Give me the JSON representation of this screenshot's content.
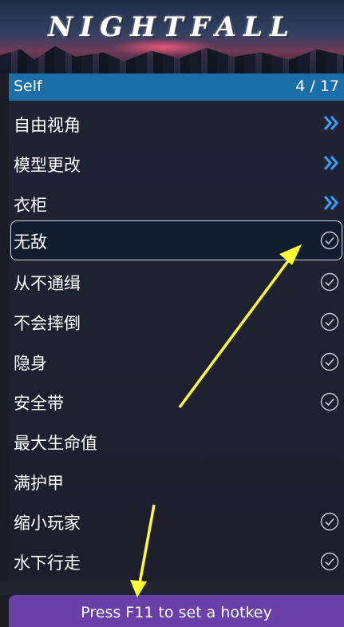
{
  "banner": {
    "title": "NIGHTFALL"
  },
  "menu": {
    "header_label": "Self",
    "counter": "4 / 17",
    "items": [
      {
        "label": "自由视角",
        "icon": "chevron-right-double-icon"
      },
      {
        "label": "模型更改",
        "icon": "chevron-right-double-icon"
      },
      {
        "label": "衣柜",
        "icon": "chevron-right-double-icon"
      },
      {
        "label": "无敌",
        "icon": "check-circle-icon",
        "selected": true
      },
      {
        "label": "从不通缉",
        "icon": "check-circle-icon"
      },
      {
        "label": "不会摔倒",
        "icon": "check-circle-icon"
      },
      {
        "label": "隐身",
        "icon": "check-circle-icon"
      },
      {
        "label": "安全带",
        "icon": "check-circle-icon"
      },
      {
        "label": "最大生命值",
        "icon": ""
      },
      {
        "label": "满护甲",
        "icon": ""
      },
      {
        "label": "缩小玩家",
        "icon": "check-circle-icon"
      },
      {
        "label": "水下行走",
        "icon": "check-circle-icon"
      }
    ]
  },
  "hint": "Press F11 to set a hotkey",
  "colors": {
    "header_bg": "#1a6fa8",
    "hint_bg": "#6b3fa8",
    "chevron": "#3aa0ff",
    "annotation_arrow": "#ffff33"
  }
}
